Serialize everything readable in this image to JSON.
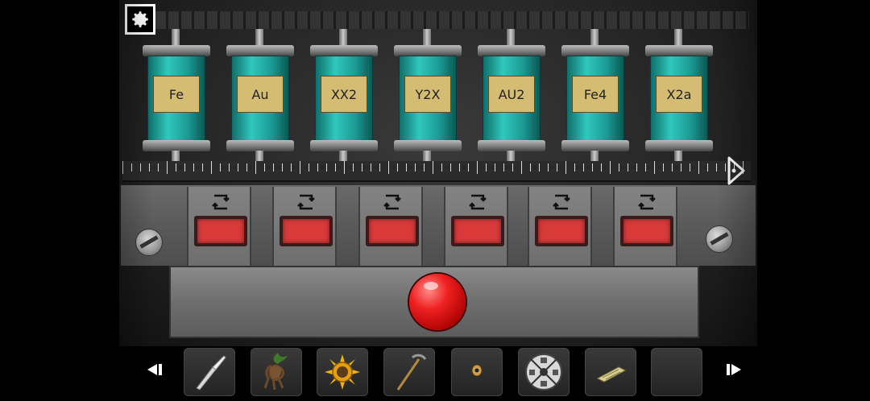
{
  "canisters": [
    {
      "label": "Fe"
    },
    {
      "label": "Au"
    },
    {
      "label": "XX2"
    },
    {
      "label": "Y2X"
    },
    {
      "label": "AU2"
    },
    {
      "label": "Fe4"
    },
    {
      "label": "X2a"
    }
  ],
  "slots": [
    {
      "light_color": "#d83a3a"
    },
    {
      "light_color": "#d83a3a"
    },
    {
      "light_color": "#d83a3a"
    },
    {
      "light_color": "#d83a3a"
    },
    {
      "light_color": "#d83a3a"
    },
    {
      "light_color": "#d83a3a"
    }
  ],
  "inventory": [
    {
      "icon": "scalpel-icon"
    },
    {
      "icon": "mandrake-root-icon"
    },
    {
      "icon": "sun-medallion-icon"
    },
    {
      "icon": "pickaxe-icon"
    },
    {
      "icon": "eye-bead-icon"
    },
    {
      "icon": "symbol-disc-icon"
    },
    {
      "icon": "paper-note-icon"
    },
    {
      "icon": "empty-slot"
    }
  ],
  "colors": {
    "canister_teal": "#2fc8be",
    "label_gold": "#d4bc72",
    "light_red": "#d83a3a",
    "button_red": "#ee2020"
  }
}
